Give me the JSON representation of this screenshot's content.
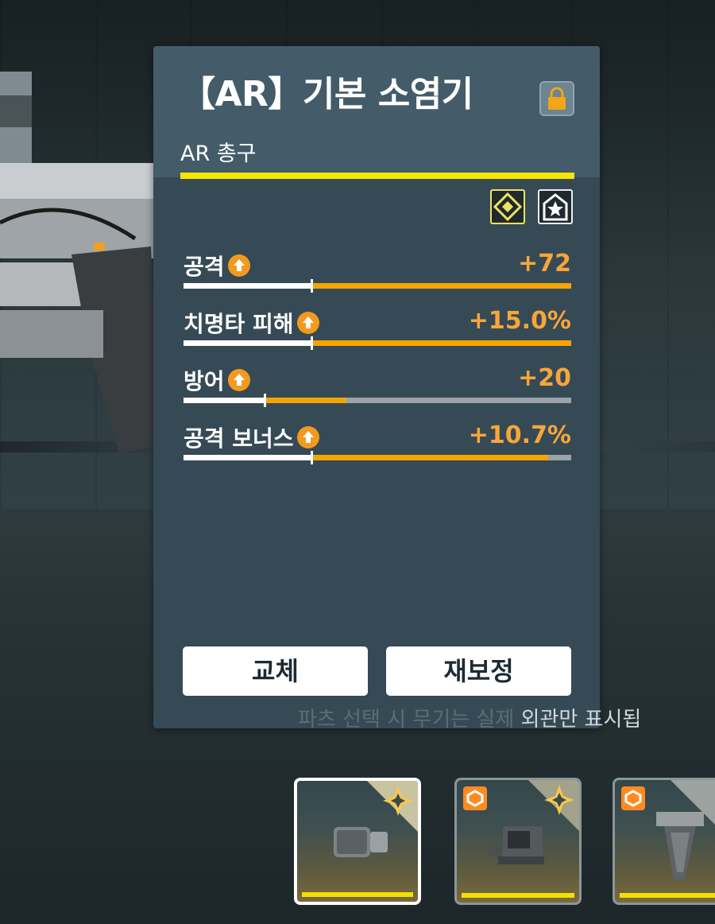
{
  "panel": {
    "title": "【AR】기본 소염기",
    "subtitle": "AR 총구",
    "accent_color": "#f6e600",
    "badges": [
      "diamond-rank-icon",
      "star-chevron-icon"
    ]
  },
  "stats": [
    {
      "name": "공격",
      "value": "+72",
      "base_fill": 0.33,
      "bonus_fill": 1.0
    },
    {
      "name": "치명타 피해",
      "value": "+15.0%",
      "base_fill": 0.33,
      "bonus_fill": 1.0
    },
    {
      "name": "방어",
      "value": "+20",
      "base_fill": 0.21,
      "bonus_fill": 0.42
    },
    {
      "name": "공격 보너스",
      "value": "+10.7%",
      "base_fill": 0.33,
      "bonus_fill": 0.94
    }
  ],
  "buttons": {
    "swap": "교체",
    "recalibrate": "재보정"
  },
  "hint": {
    "faded": "파츠 선택 시 무기는 실제 ",
    "visible": "외관만 표시됩"
  },
  "slots": [
    {
      "item": "muzzle",
      "selected": true
    },
    {
      "item": "sight",
      "selected": false
    },
    {
      "item": "grip",
      "selected": false
    }
  ],
  "colors": {
    "panel_bg": "#364a55",
    "stat_value": "#f7a63a",
    "bar_orange": "#f5a500"
  }
}
